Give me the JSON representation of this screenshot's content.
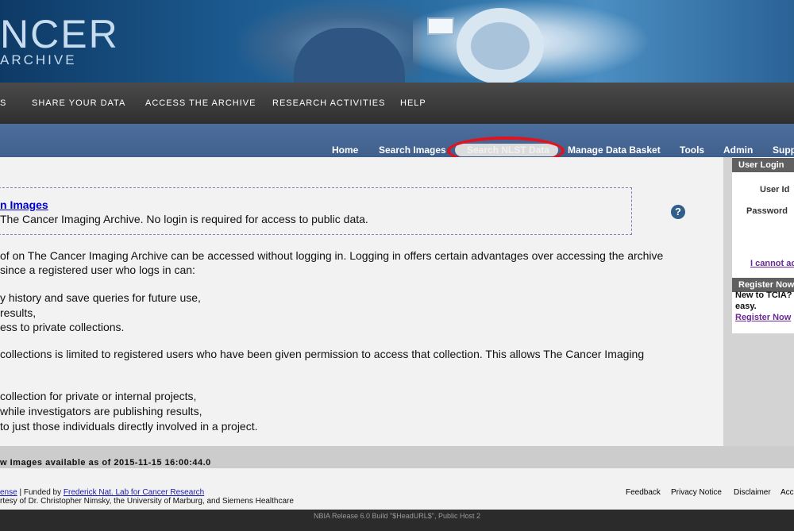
{
  "logo": {
    "main": "NCER",
    "sub": "ARCHIVE"
  },
  "main_nav": {
    "items": [
      "S",
      "SHARE YOUR DATA",
      "ACCESS THE ARCHIVE",
      "RESEARCH ACTIVITIES",
      "HELP"
    ]
  },
  "sub_nav": {
    "items": [
      "Home",
      "Search Images",
      "Search NLST Data",
      "Manage Data Basket",
      "Tools",
      "Admin",
      "Supp"
    ],
    "active": "Search NLST Data"
  },
  "notice": {
    "title": "n Images",
    "text": "The Cancer Imaging Archive. No login is required for access to public data."
  },
  "help_icon": "question-icon",
  "paragraphs": [
    "of on The Cancer Imaging Archive can be accessed without logging in. Logging in offers certain advantages over accessing the archive",
    "since a registered user who logs in can:",
    "y history and save queries for future use,",
    "results,",
    "ess to private collections.",
    "collections is limited to registered users who have been given permission to access that collection. This allows The Cancer Imaging",
    "collection for private or internal projects,",
    "while investigators are publishing results,",
    "to just those individuals directly involved in a project."
  ],
  "status": "w Images available as of 2015-11-15 16:00:44.0",
  "footer": {
    "license_link": "ense",
    "funded_text": " | Funded by ",
    "funded_link": "Frederick Nat. Lab for Cancer Research",
    "courtesy": "rtesy of Dr. Christopher Nimsky, the University of Marburg, and Siemens Healthcare",
    "links": [
      "Feedback",
      "Privacy Notice",
      "Disclaimer",
      "Acc"
    ]
  },
  "release": "NBIA Release 6.0 Build \"$HeadURL$\", Public Host 2",
  "sidebar": {
    "login_title": "User Login",
    "user_id_label": "User Id",
    "password_label": "Password",
    "cannot_access_link": "I cannot ac",
    "register_title": "Register Now",
    "new_to": "New to TCIA?",
    "easy": "easy.",
    "register_link": "Register Now"
  },
  "colors": {
    "highlight_ring": "#e0141e",
    "subnav_bg": "#4d6f9e",
    "mainnav_bg": "#2f2f2f",
    "link": "#0000cc"
  }
}
